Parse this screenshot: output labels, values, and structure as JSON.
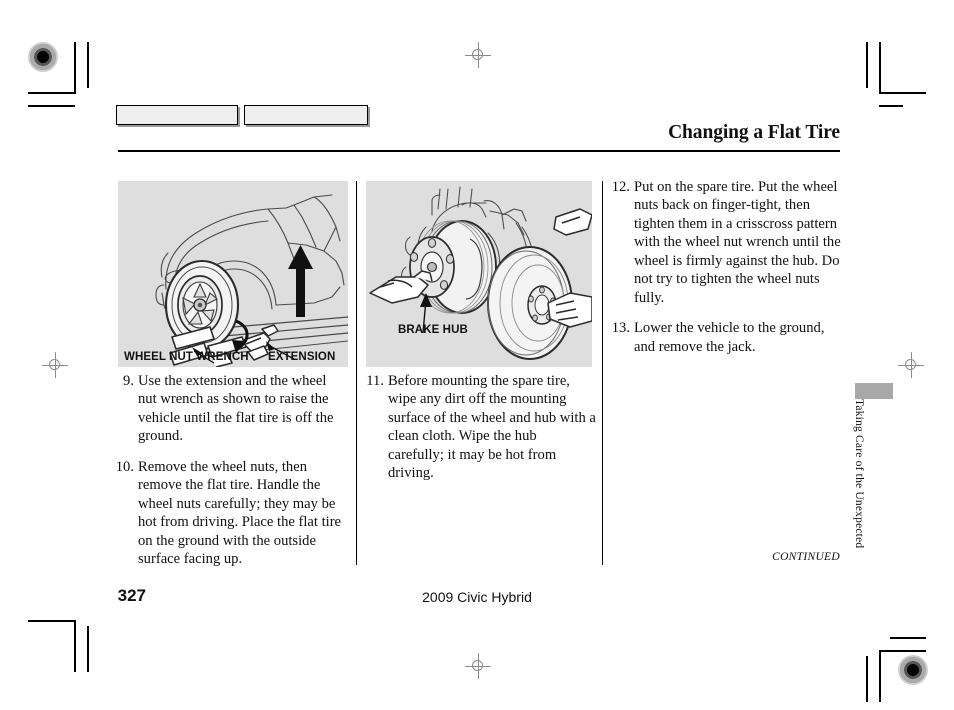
{
  "header": {
    "title": "Changing a Flat Tire"
  },
  "illustrations": [
    {
      "id": "wheel-nut-wrench-illustration",
      "alt": "Car being raised with jack using the wheel nut wrench and extension",
      "labels": [
        {
          "text": "WHEEL NUT WRENCH"
        },
        {
          "text": "EXTENSION"
        }
      ]
    },
    {
      "id": "brake-hub-illustration",
      "alt": "Wiping the brake hub mounting surface and mounting the spare tire",
      "labels": [
        {
          "text": "BRAKE HUB"
        }
      ]
    }
  ],
  "columns": [
    {
      "id": "column-left",
      "steps": [
        {
          "number": "9.",
          "text": "Use the extension and the wheel nut wrench as shown to raise the vehicle until the flat tire is off the ground."
        },
        {
          "number": "10.",
          "text": "Remove the wheel nuts, then remove the flat tire. Handle the wheel nuts carefully; they may be hot from driving. Place the flat tire on the ground with the outside surface facing up."
        }
      ]
    },
    {
      "id": "column-middle",
      "steps": [
        {
          "number": "11.",
          "text": "Before mounting the spare tire, wipe any dirt off the mounting surface of the wheel and hub with a clean cloth. Wipe the hub carefully; it may be hot from driving."
        }
      ]
    },
    {
      "id": "column-right",
      "steps": [
        {
          "number": "12.",
          "text": "Put on the spare tire. Put the wheel nuts back on finger-tight, then tighten them in a crisscross pattern with the wheel nut wrench until the wheel is firmly against the hub. Do not try to tighten the wheel nuts fully."
        },
        {
          "number": "13.",
          "text": "Lower the vehicle to the ground, and remove the jack."
        }
      ]
    }
  ],
  "footer": {
    "continued": "CONTINUED",
    "model": "2009  Civic  Hybrid",
    "page_number": "327"
  },
  "side_tab": {
    "label": "Taking Care of the Unexpected",
    "block_color": "#a8a8a8"
  },
  "colors": {
    "illustration_background": "#dedede",
    "text": "#111111",
    "rule": "#000000",
    "swatch_fill": "#efefef"
  }
}
